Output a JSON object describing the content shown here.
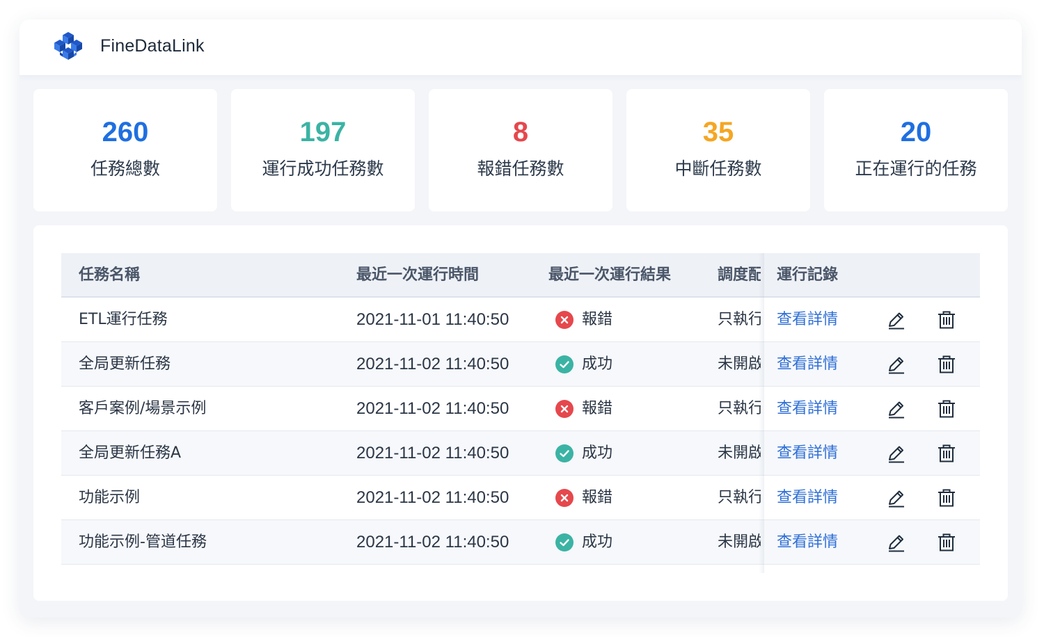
{
  "app": {
    "title": "FineDataLink",
    "logo_icon": "cube-cluster-logo-icon"
  },
  "stats": [
    {
      "value": "260",
      "label": "任務總數",
      "color": "#1f6fe0"
    },
    {
      "value": "197",
      "label": "運行成功任務數",
      "color": "#3bb3a4"
    },
    {
      "value": "8",
      "label": "報錯任務數",
      "color": "#e5484d"
    },
    {
      "value": "35",
      "label": "中斷任務數",
      "color": "#f5a623"
    },
    {
      "value": "20",
      "label": "正在運行的任務",
      "color": "#1f6fe0"
    }
  ],
  "table": {
    "headers": {
      "name": "任務名稱",
      "time": "最近一次運行時間",
      "result": "最近一次運行結果",
      "schedule": "調度配置",
      "log": "運行記錄"
    },
    "rows": [
      {
        "name": "ETL運行任務",
        "time": "2021-11-01 11:40:50",
        "status": "error",
        "result": "報錯",
        "schedule": "只執行",
        "link": "查看詳情"
      },
      {
        "name": "全局更新任務",
        "time": "2021-11-02 11:40:50",
        "status": "success",
        "result": "成功",
        "schedule": "未開啟",
        "link": "查看詳情"
      },
      {
        "name": "客戶案例/場景示例",
        "time": "2021-11-02 11:40:50",
        "status": "error",
        "result": "報錯",
        "schedule": "只執行",
        "link": "查看詳情"
      },
      {
        "name": "全局更新任務A",
        "time": "2021-11-02 11:40:50",
        "status": "success",
        "result": "成功",
        "schedule": "未開啟",
        "link": "查看詳情"
      },
      {
        "name": "功能示例",
        "time": "2021-11-02 11:40:50",
        "status": "error",
        "result": "報錯",
        "schedule": "只執行",
        "link": "查看詳情"
      },
      {
        "name": "功能示例-管道任務",
        "time": "2021-11-02 11:40:50",
        "status": "success",
        "result": "成功",
        "schedule": "未開啟",
        "link": "查看詳情"
      }
    ],
    "icons": {
      "edit": "edit-pencil-icon",
      "delete": "trash-icon",
      "error": "error-x-circle-icon",
      "success": "success-check-circle-icon"
    },
    "colors": {
      "error": "#e5484d",
      "success": "#3bb3a4",
      "link": "#2f6fd6"
    }
  }
}
